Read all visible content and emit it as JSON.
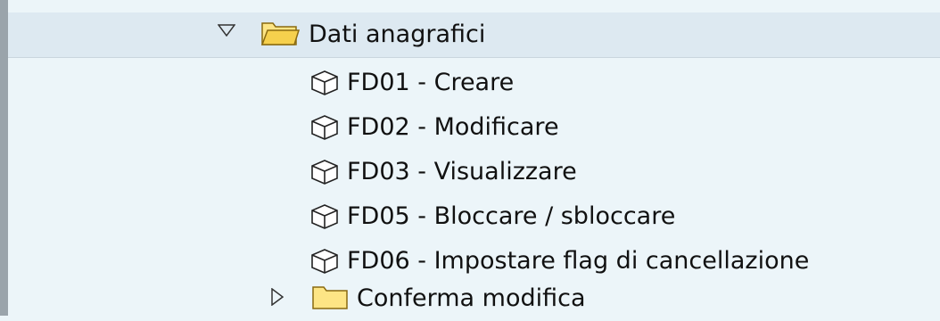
{
  "tree": {
    "folder_open": {
      "label": "Dati anagrafici",
      "expander_icon": "triangle-down-icon",
      "icon": "open-folder-icon"
    },
    "items": [
      {
        "label": "FD01 - Creare",
        "icon": "cube-icon"
      },
      {
        "label": "FD02 - Modificare",
        "icon": "cube-icon"
      },
      {
        "label": "FD03 - Visualizzare",
        "icon": "cube-icon"
      },
      {
        "label": "FD05 - Bloccare / sbloccare",
        "icon": "cube-icon"
      },
      {
        "label": "FD06 - Impostare flag di cancellazione",
        "icon": "cube-icon"
      }
    ],
    "folder_closed": {
      "label": "Conferma modifica",
      "expander_icon": "triangle-right-icon",
      "icon": "folder-icon"
    }
  },
  "colors": {
    "background": "#ecf5f9",
    "header_row": "#dde9f1",
    "folder_fill": "#fde585",
    "folder_stroke": "#8a6a10"
  }
}
